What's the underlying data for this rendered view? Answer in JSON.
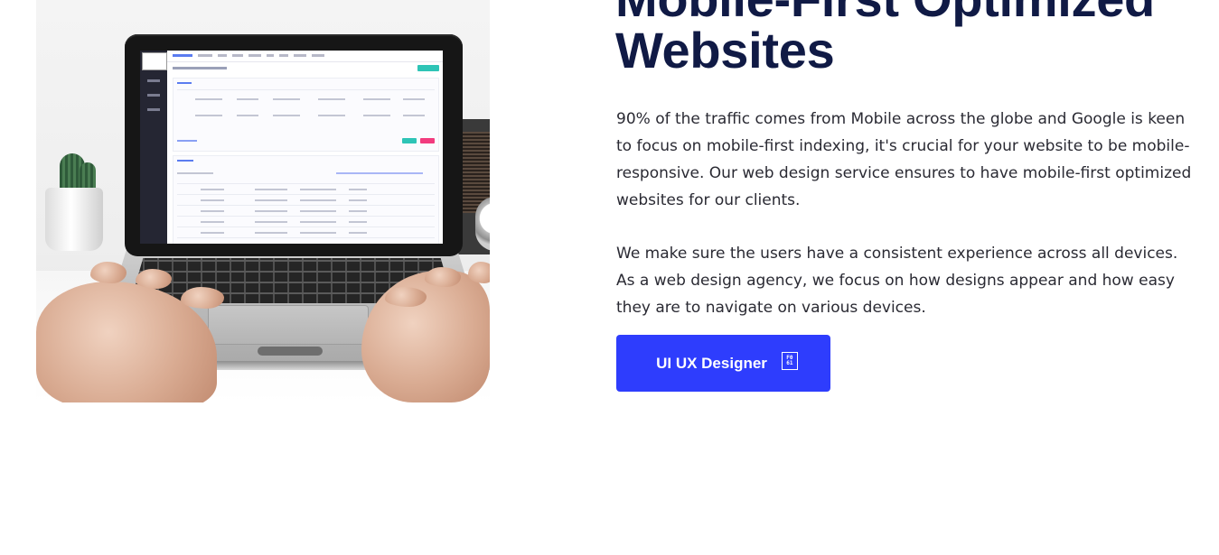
{
  "section": {
    "heading": "Mobile-First Optimized Websites",
    "paragraph_1": "90% of the traffic comes from Mobile across the globe and Google is keen to focus on mobile-first indexing, it's crucial for your website to be mobile-responsive. Our web design service ensures to have mobile-first optimized websites for our clients.",
    "paragraph_2": "We make sure the users have a consistent experience across all devices. As a web design agency, we focus on how designs appear and how easy they are to navigate on various devices.",
    "cta": {
      "label": "UI UX Designer",
      "icon": "qr-code-icon",
      "icon_text_top": "F0",
      "icon_text_bottom": "61"
    }
  },
  "image": {
    "description_icon": "laptop-with-hands-photo"
  },
  "colors": {
    "heading": "#101a45",
    "body_text": "#2a2a33",
    "cta_background": "#2e3dfd",
    "cta_text": "#ffffff"
  }
}
